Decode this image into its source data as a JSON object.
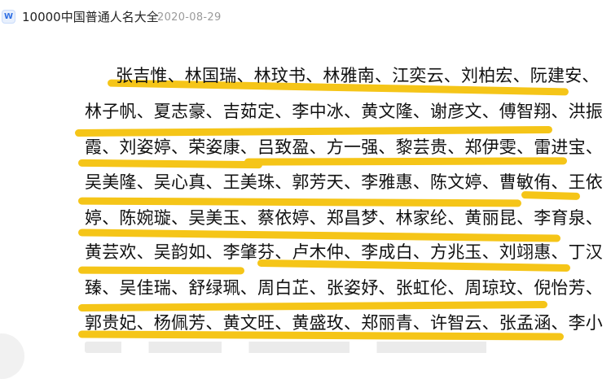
{
  "header": {
    "app_icon": "wps-writer-doc-icon",
    "app_icon_letter": "W",
    "title": "10000中国普通人名大全",
    "date": "2020-08-29"
  },
  "document": {
    "lines": [
      "张吉惟、林国瑞、林玟书、林雅南、江奕云、刘柏宏、阮建安、",
      "林子帆、夏志豪、吉茹定、李中冰、黄文隆、谢彦文、傅智翔、洪振",
      "霞、刘姿婷、荣姿康、吕致盈、方一强、黎芸贵、郑伊雯、雷进宝、",
      "吴美隆、吴心真、王美珠、郭芳天、李雅惠、陈文婷、曹敏侑、王依",
      "婷、陈婉璇、吴美玉、蔡依婷、郑昌梦、林家纶、黄丽昆、李育泉、",
      "黄芸欢、吴韵如、李肇芬、卢木仲、李成白、方兆玉、刘翊惠、丁汉",
      "臻、吴佳瑞、舒绿珮、周白芷、张姿妤、张虹伦、周琼玟、倪怡芳、",
      "郭贵妃、杨佩芳、黄文旺、黄盛玫、郑丽青、许智云、张孟涵、李小"
    ],
    "highlight_color": "#f5c518"
  }
}
